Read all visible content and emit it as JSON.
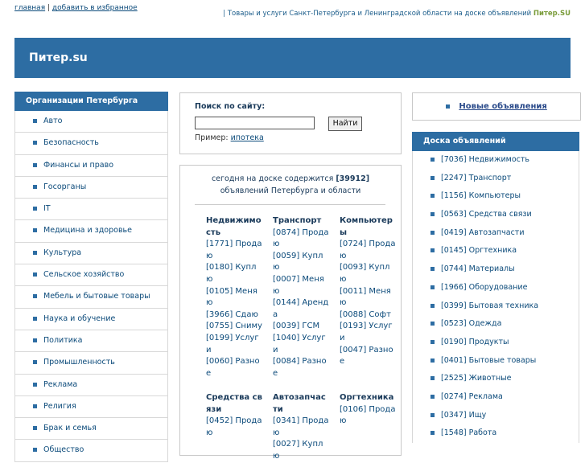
{
  "top_links": {
    "home": "главная",
    "separator": "|",
    "favorites": "добавить в избранное"
  },
  "tagline": {
    "text": "| Товары и услуги Санкт-Петербурга и Ленинградской области на доске объявлений",
    "brand": "Питер.SU"
  },
  "header": {
    "title": "Питер.su"
  },
  "left": {
    "title": "Организации Петербурга",
    "items": [
      "Авто",
      "Безопасность",
      "Финансы и право",
      "Госорганы",
      "IT",
      "Медицина и здоровье",
      "Культура",
      "Сельское хозяйство",
      "Мебель и бытовые товары",
      "Наука и обучение",
      "Политика",
      "Промышленность",
      "Реклама",
      "Религия",
      "Брак и семья",
      "Общество"
    ]
  },
  "search": {
    "label": "Поиск по сайту:",
    "value": "",
    "button": "Найти",
    "example_label": "Пример:",
    "example_link": "ипотека"
  },
  "board": {
    "intro_before": "сегодня на доске содержится",
    "count": "[39912]",
    "intro_after": "объявлений Петербурга и области",
    "categories": [
      {
        "title": "Недвижимость",
        "lines": [
          "[1771] Продаю",
          "[0180] Куплю",
          "[0105] Меняю",
          "[3966] Сдаю",
          "[0755] Сниму",
          "[0199] Услуги",
          "[0060] Разное"
        ]
      },
      {
        "title": "Транспорт",
        "lines": [
          "[0874] Продаю",
          "[0059] Куплю",
          "[0007] Меняю",
          "[0144] Аренда",
          "[0039] ГСМ",
          "[1040] Услуги",
          "[0084] Разное"
        ]
      },
      {
        "title": "Компьютеры",
        "lines": [
          "[0724] Продаю",
          "[0093] Куплю",
          "[0011] Меняю",
          "[0088] Софт",
          "[0193] Услуги",
          "[0047] Разное"
        ]
      },
      {
        "title": "Средства связи",
        "lines": [
          "[0452] Продаю"
        ]
      },
      {
        "title": "Автозапчасти",
        "lines": [
          "[0341] Продаю",
          "[0027] Куплю"
        ]
      },
      {
        "title": "Оргтехника",
        "lines": [
          "[0106] Продаю"
        ]
      }
    ]
  },
  "right": {
    "new_ads": "Новые объявления",
    "title": "Доска объявлений",
    "items": [
      "[7036] Недвижимость",
      "[2247] Транспорт",
      "[1156] Компьютеры",
      "[0563] Средства связи",
      "[0419] Автозапчасти",
      "[0145] Оргтехника",
      "[0744] Материалы",
      "[1966] Оборудование",
      "[0399] Бытовая техника",
      "[0523] Одежда",
      "[0190] Продукты",
      "[0401] Бытовые товары",
      "[2525] Животные",
      "[0274] Реклама",
      "[0347] Ищу",
      "[1548] Работа"
    ]
  },
  "colors": {
    "accent": "#2d6da3",
    "link": "#0b4a7a",
    "brand": "#7a9c3a"
  }
}
